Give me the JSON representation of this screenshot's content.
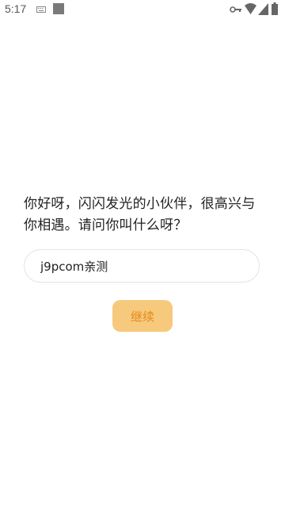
{
  "status_bar": {
    "time": "5:17",
    "icons": [
      "keyboard-icon",
      "notification-square-icon",
      "vpn-key-icon",
      "wifi-icon",
      "signal-icon",
      "battery-icon"
    ]
  },
  "prompt": {
    "text": "你好呀，闪闪发光的小伙伴，很高兴与你相遇。请问你叫什么呀？"
  },
  "name_input": {
    "value": "j9pcom亲测"
  },
  "continue_button": {
    "label": "继续"
  },
  "colors": {
    "button_bg": "#f6c97c",
    "button_text": "#e58a1a",
    "input_border": "#e3e3e3"
  }
}
